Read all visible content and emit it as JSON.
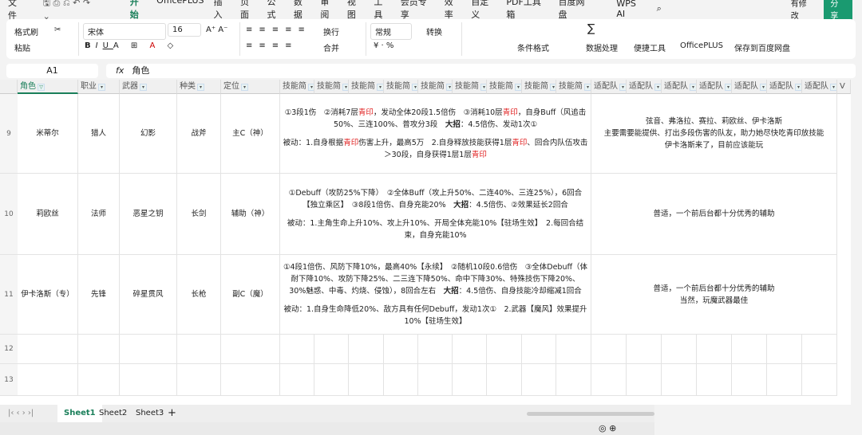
{
  "menu": {
    "file": "文件",
    "tabs": [
      "开始",
      "OfficePLUS",
      "插入",
      "页面",
      "公式",
      "数据",
      "审阅",
      "视图",
      "工具",
      "会员专享",
      "效率",
      "自定义",
      "PDF工具箱",
      "百度网盘"
    ],
    "wps_ai": "WPS AI",
    "modified": "有修改",
    "share": "分享"
  },
  "ribbon": {
    "format_painter": "格式刷",
    "paste": "粘贴",
    "font": "宋体",
    "size": "16",
    "wrap": "换行",
    "merge": "合并",
    "number_format": "常规",
    "convert": "转换",
    "conditional": "条件格式",
    "data_process": "数据处理",
    "quick_tools": "便捷工具",
    "officeplus": "OfficePLUS",
    "save_baidu": "保存到百度网盘"
  },
  "formula_bar": {
    "cell_ref": "A1",
    "fx": "fx",
    "value": "角色"
  },
  "headers": [
    "角色",
    "职业",
    "武器",
    "种类",
    "定位",
    "技能简",
    "技能简",
    "技能简",
    "技能简",
    "技能简",
    "技能简",
    "技能简",
    "技能简",
    "技能简",
    "适配队",
    "适配队",
    "适配队",
    "适配队",
    "适配队",
    "适配队",
    "适配队",
    "V"
  ],
  "rows": [
    {
      "num": "9",
      "role": "米蒂尔",
      "job": "猎人",
      "weapon": "幻影",
      "type": "战斧",
      "position": "主C（神）",
      "skill1_parts": [
        "①3段1伤　②消耗7层",
        "青印",
        "，发动全体20段1.5倍伤　③消耗10层",
        "青印",
        "，自身Buff（风追击50%、三连100%、普攻分3段　",
        "大招",
        "：4.5倍伤、发动1次①"
      ],
      "skill2_parts": [
        "被动：1.自身根据",
        "青印",
        "伤害上升，最高5万　2.自身释放技能获得1层",
        "青印",
        "、回合内队伍攻击＞30段，自身获得1层1层",
        "青印"
      ],
      "team": [
        "弦音、弗洛拉、赛拉、莉欧丝、伊卡洛斯",
        "主要需要能提供、打出多段伤害的队友，助力她尽快吃青印放技能",
        "伊卡洛斯来了，目前应该能玩"
      ]
    },
    {
      "num": "10",
      "role": "莉欧丝",
      "job": "法师",
      "weapon": "恶星之钥",
      "type": "长剑",
      "position": "辅助（神）",
      "skill1_parts": [
        "①Debuff（攻防25%下降）　②全体Buff（攻上升50%、二连40%、三连25%），6回合【独立乘区】　③8段1倍伤、自身充能20%　",
        "大招",
        "：4.5倍伤、②效果延长2回合"
      ],
      "skill2": "被动：1.主角生命上升10%、攻上升10%、开局全体充能10%【驻场生效】　2.每回合结束，自身充能10%",
      "team": [
        "普适，一个前后台都十分优秀的辅助"
      ]
    },
    {
      "num": "11",
      "role": "伊卡洛斯（专）",
      "job": "先锋",
      "weapon": "碎星贯风",
      "type": "长枪",
      "position": "副C（魔）",
      "skill1_parts": [
        "①4段1倍伤、风防下降10%，最高40%【永续】　②随机10段0.6倍伤　③全体Debuff（体耐下降10%、攻防下降25%、二三连下降50%、命中下降30%、特殊技伤下降20%、30%魅惑、中毒、灼烧、侵蚀），8回合左右　",
        "大招",
        "：4.5倍伤、自身技能冷却缩减1回合"
      ],
      "skill2": "被动：1.自身生命降低20%、敌方具有任何Debuff，发动1次①　2.武器【魔风】效果提升10%【驻场生效】",
      "team": [
        "普适，一个前后台都十分优秀的辅助",
        "当然，玩魔武器最佳"
      ]
    },
    {
      "num": "12"
    },
    {
      "num": "13"
    }
  ],
  "sheets": [
    "Sheet1",
    "Sheet2",
    "Sheet3"
  ],
  "colors": {
    "accent": "#1a7f5a",
    "red": "#e02020"
  }
}
